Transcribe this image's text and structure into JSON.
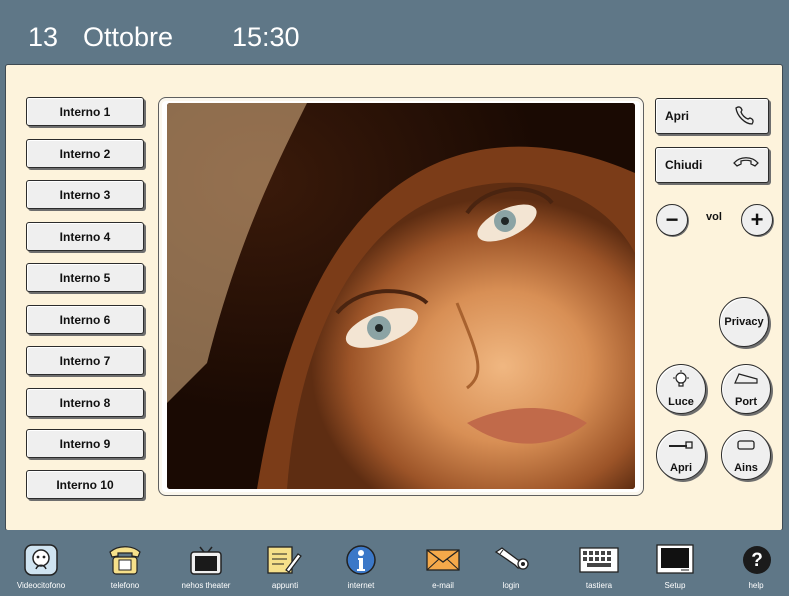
{
  "header": {
    "day": "13",
    "month": "Ottobre",
    "time": "15:30"
  },
  "extensions": [
    "Interno 1",
    "Interno 2",
    "Interno 3",
    "Interno 4",
    "Interno 5",
    "Interno 6",
    "Interno 7",
    "Interno 8",
    "Interno 9",
    "Interno 10"
  ],
  "controls": {
    "open_label": "Apri",
    "close_label": "Chiudi",
    "vol_label": "vol",
    "privacy_label": "Privacy",
    "light_label": "Luce",
    "port_label": "Port",
    "open_door_label": "Apri",
    "ains_label": "Ains"
  },
  "dock": [
    {
      "label": "Videocitofono",
      "icon": "videointercom-icon"
    },
    {
      "label": "telefono",
      "icon": "telephone-icon"
    },
    {
      "label": "nehos theater",
      "icon": "tv-icon"
    },
    {
      "label": "appunti",
      "icon": "notepad-icon"
    },
    {
      "label": "internet",
      "icon": "internet-icon"
    },
    {
      "label": "e-mail",
      "icon": "envelope-icon"
    },
    {
      "label": "login",
      "icon": "key-icon"
    },
    {
      "label": "tastiera",
      "icon": "keyboard-icon"
    },
    {
      "label": "Setup",
      "icon": "monitor-icon"
    },
    {
      "label": "help",
      "icon": "help-icon"
    }
  ]
}
